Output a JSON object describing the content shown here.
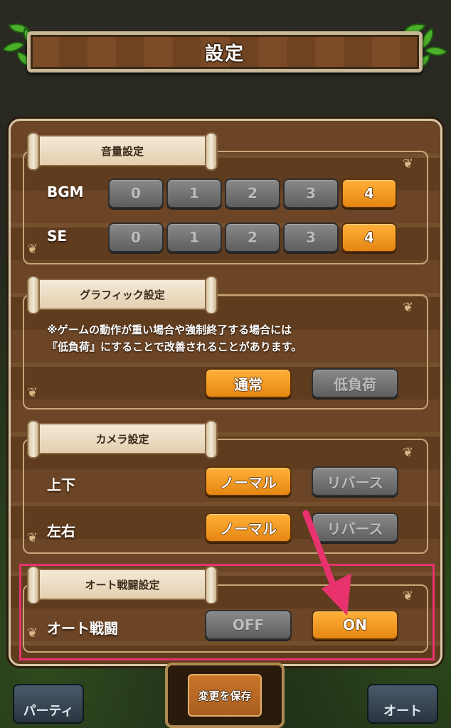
{
  "header": {
    "title": "設定"
  },
  "volume": {
    "heading": "音量設定",
    "bgm": {
      "label": "BGM",
      "options": [
        "0",
        "1",
        "2",
        "3",
        "4"
      ],
      "selected": "4"
    },
    "se": {
      "label": "SE",
      "options": [
        "0",
        "1",
        "2",
        "3",
        "4"
      ],
      "selected": "4"
    }
  },
  "graphics": {
    "heading": "グラフィック設定",
    "note_line1": "※ゲームの動作が重い場合や強制終了する場合には",
    "note_line2": "『低負荷』にすることで改善されることがあります。",
    "normal": "通常",
    "low": "低負荷",
    "selected": "通常"
  },
  "camera": {
    "heading": "カメラ設定",
    "vertical": {
      "label": "上下",
      "normal": "ノーマル",
      "reverse": "リバース",
      "selected": "ノーマル"
    },
    "horizontal": {
      "label": "左右",
      "normal": "ノーマル",
      "reverse": "リバース",
      "selected": "ノーマル"
    }
  },
  "auto_battle": {
    "heading": "オート戦闘設定",
    "label": "オート戦闘",
    "off": "OFF",
    "on": "ON",
    "selected": "ON"
  },
  "footer": {
    "save": "変更を保存",
    "party": "パーティ",
    "auto": "オート"
  },
  "colors": {
    "selected": "#f0961e",
    "unselected": "#6e6e6e",
    "highlight": "#e8326e"
  }
}
